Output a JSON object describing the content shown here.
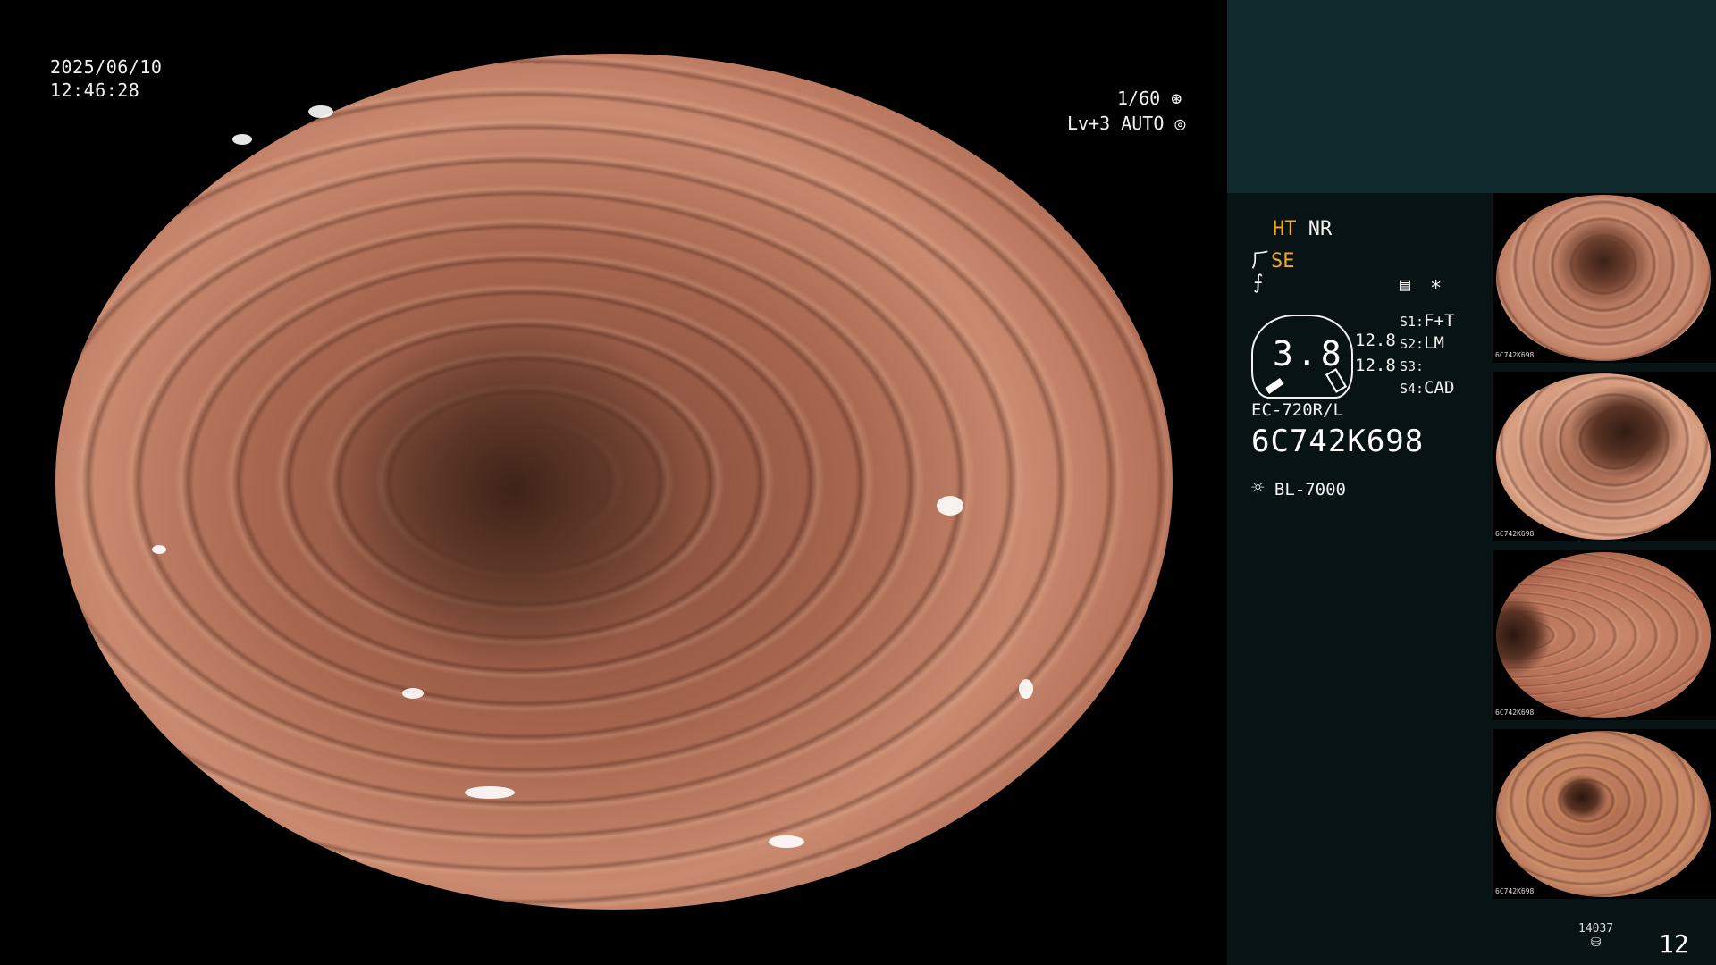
{
  "overlay": {
    "date": "2025/06/10",
    "time": "12:46:28",
    "shutter": "1/60",
    "shutter_icon": "aperture-icon",
    "level": "Lv+3 AUTO",
    "level_icon": "auto-exposure-icon"
  },
  "settings": {
    "ht": "HT",
    "nr": "NR",
    "se": "SE",
    "ht_color": "#f5a623",
    "se_color": "#f5a623"
  },
  "gauge": {
    "value": "3.8",
    "right_value_1": "12.8",
    "right_value_2": "12.8"
  },
  "switches": [
    {
      "key": "S1:",
      "value": "F+T"
    },
    {
      "key": "S2:",
      "value": "LM"
    },
    {
      "key": "S3:",
      "value": ""
    },
    {
      "key": "S4:",
      "value": "CAD"
    }
  ],
  "scope": {
    "model": "EC-720R/L",
    "serial": "6C742K698",
    "light_source": "BL-7000"
  },
  "thumbnails": [
    {
      "label_1": "6C742K698"
    },
    {
      "label_1": "6C742K698"
    },
    {
      "label_1": "6C742K698"
    },
    {
      "label_1": "6C742K698"
    }
  ],
  "footer": {
    "count": "14037",
    "page": "12"
  },
  "colors": {
    "panel_top": "#0e2a2c",
    "panel": "#071314",
    "accent": "#f5a623"
  }
}
